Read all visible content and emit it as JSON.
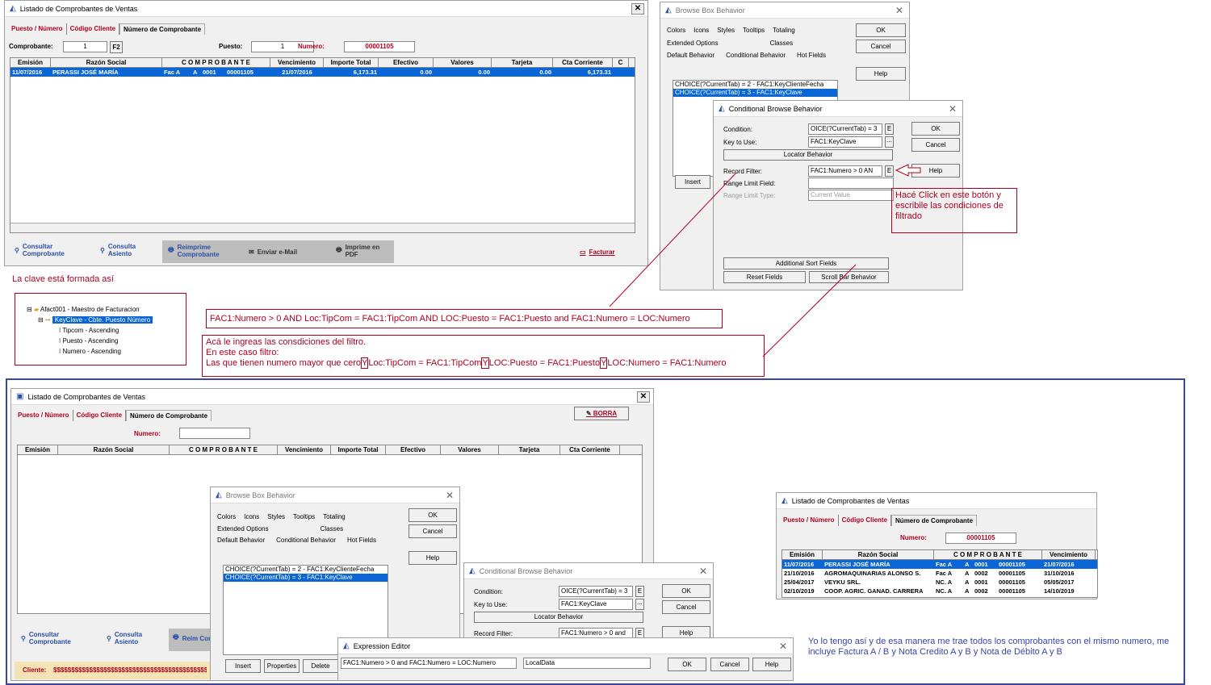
{
  "w1": {
    "title": "Listado de Comprobantes de Ventas",
    "tabs": [
      "Puesto / Número",
      "Código Cliente",
      "Número de Comprobante"
    ],
    "comprobante_label": "Comprobante:",
    "comprobante_value": "1",
    "f2": "F2",
    "puesto_label": "Puesto:",
    "puesto_value": "1",
    "numero_label": "Numero:",
    "numero_value": "00001105",
    "headers": [
      "Emisión",
      "Razón Social",
      "C O M P R O B A N T E",
      "Vencimiento",
      "Importe Total",
      "Efectivo",
      "Valores",
      "Tarjeta",
      "Cta Corriente",
      "C"
    ],
    "row": [
      "11/07/2016",
      "PERASSI JOSÉ MARÍA",
      "Fac A",
      "A",
      "0001",
      "00001105",
      "21/07/2016",
      "6,173.31",
      "0.00",
      "0.00",
      "0.00",
      "6,173.31"
    ],
    "buttons": {
      "consultar": "Consultar Comprobante",
      "consulta_asiento": "Consulta Asiento",
      "reimprime": "Reimprime Comprobante",
      "email": "Enviar e-Mail",
      "pdf": "Imprime en PDF",
      "facturar": "Facturar"
    }
  },
  "bbb": {
    "title": "Browse Box Behavior",
    "tabs1": [
      "Colors",
      "Icons",
      "Styles",
      "Tooltips",
      "Totaling"
    ],
    "tabs2": [
      "Extended Options",
      "Classes"
    ],
    "tabs3": [
      "Default Behavior",
      "Conditional Behavior",
      "Hot Fields"
    ],
    "ok": "OK",
    "cancel": "Cancel",
    "help": "Help",
    "insert": "Insert",
    "properties": "Properties",
    "delete": "Delete",
    "items": [
      "CHOICE(?CurrentTab) = 2 - FAC1:KeyClienteFecha",
      "CHOICE(?CurrentTab) = 3 - FAC1:KeyClave"
    ]
  },
  "cbb": {
    "title": "Conditional Browse Behavior",
    "condition_label": "Condition:",
    "condition_value": "OICE(?CurrentTab) = 3",
    "e": "E",
    "key_label": "Key to Use:",
    "key_value": "FAC1:KeyClave",
    "dots": "...",
    "locator": "Locator Behavior",
    "filter_label": "Record Filter:",
    "filter_value": "FAC1:Numero > 0  AN",
    "filter_value2": "FAC1:Numero > 0  and",
    "range_field_label": "Range Limit Field:",
    "range_type_label": "Range Limit Type:",
    "range_type_value": "Current Value",
    "sort": "Additional Sort Fields",
    "reset": "Reset Fields",
    "scroll": "Scroll Bar Behavior",
    "ok": "OK",
    "cancel": "Cancel",
    "help": "Help"
  },
  "notes": {
    "click": "Hacé Click en este botón y escribile las condiciones de filtrado",
    "clave": "La clave está formada así",
    "expr": "FAC1:Numero > 0  AND Loc:TipCom = FAC1:TipCom AND LOC:Puesto = FAC1:Puesto and FAC1:Numero = LOC:Numero",
    "ingresas1": "Acá le ingreas las consdiciones del filtro.",
    "ingresas2": "En este caso filtro:",
    "ingresas3a": "Las que tienen numero mayor que cero",
    "y": "Y",
    "ingresas3b": "Loc:TipCom = FAC1:TipCom",
    "ingresas3c": "LOC:Puesto = FAC1:Puesto",
    "ingresas3d": "LOC:Numero = FAC1:Numero",
    "yo": "Yo lo tengo así y de esa manera me trae todos los comprobantes con el mismo numero, me incluye   Factura A / B y Nota Credito A y B y Nota de Débito A y B"
  },
  "tree": [
    "Afact001 - Maestro de Facturacion",
    "KeyClave - Cbte. Puesto Número",
    "Tipcom - Ascending",
    "Puesto - Ascending",
    "Numero - Ascending"
  ],
  "w2": {
    "title": "Listado de Comprobantes de Ventas",
    "borra": "BORRA",
    "numero_label": "Numero:",
    "headers": [
      "Emisión",
      "Razón Social",
      "C O M P R O B A N T E",
      "Vencimiento",
      "Importe Total",
      "Efectivo",
      "Valores",
      "Tarjeta",
      "Cta Corriente"
    ],
    "cliente": "Cliente:",
    "cliente_value": "$$$$$$$$$$$$$$$$$$$$$$$$$$$$$$$$$$$$$$$$$$$$",
    "reim": "Reim Comp"
  },
  "expr": {
    "title": "Expression Editor",
    "value": "FAC1:Numero > 0  and FAC1:Numero = LOC:Numero",
    "local": "LocalData",
    "ok": "OK",
    "cancel": "Cancel",
    "help": "Help"
  },
  "w3": {
    "title": "Listado de Comprobantes de Ventas",
    "numero_label": "Numero:",
    "numero_value": "00001105",
    "headers": [
      "Emisión",
      "Razón Social",
      "C O M P R O B A N T E",
      "Vencimiento"
    ],
    "rows": [
      [
        "11/07/2016",
        "PERASSI JOSÉ MARÍA",
        "Fac A",
        "A",
        "0001",
        "00001105",
        "21/07/2016"
      ],
      [
        "21/10/2016",
        "AGROMAQUINARIAS ALONSO S.",
        "Fac A",
        "A",
        "0002",
        "00001105",
        "31/10/2016"
      ],
      [
        "25/04/2017",
        "VEYKU SRL.",
        "NC. A",
        "A",
        "0001",
        "00001105",
        "05/05/2017"
      ],
      [
        "02/10/2019",
        "COOP. AGRIC. GANAD. CARRERA",
        "NC. A",
        "A",
        "0002",
        "00001105",
        "14/10/2019"
      ]
    ]
  },
  "colors": {
    "red": "#b00020",
    "select": "#0a66d6",
    "frame": "#3a45a8"
  }
}
